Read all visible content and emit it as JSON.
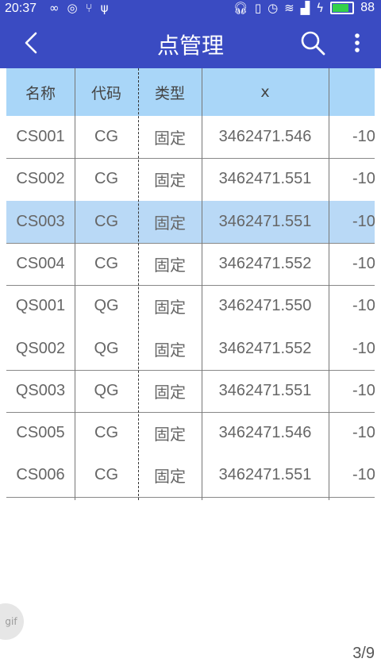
{
  "status": {
    "time": "20:37",
    "battery": "88",
    "left_icons": [
      "infinity-icon",
      "circle-p-icon",
      "usb-icon",
      "usb-plug-icon"
    ],
    "right_icons": [
      "headset-icon",
      "vibrate-icon",
      "alarm-icon",
      "wifi-icon",
      "signal-icon",
      "bolt-icon",
      "battery-icon"
    ]
  },
  "appbar": {
    "title": "点管理",
    "back_icon": "back-arrow-icon",
    "search_icon": "search-icon",
    "more_icon": "more-vert-icon",
    "color": "#3a4bc2"
  },
  "table": {
    "headers": [
      "名称",
      "代码",
      "类型",
      "x",
      ""
    ],
    "header_color": "#a9d6f8",
    "selected_color": "#b9d9f6",
    "selected_row_index": 2,
    "rows": [
      {
        "name": "CS001",
        "code": "CG",
        "type": "固定",
        "x": "3462471.546",
        "y": "-10"
      },
      {
        "name": "CS002",
        "code": "CG",
        "type": "固定",
        "x": "3462471.551",
        "y": "-10"
      },
      {
        "name": "CS003",
        "code": "CG",
        "type": "固定",
        "x": "3462471.551",
        "y": "-10"
      },
      {
        "name": "CS004",
        "code": "CG",
        "type": "固定",
        "x": "3462471.552",
        "y": "-10"
      },
      {
        "name": "QS001",
        "code": "QG",
        "type": "固定",
        "x": "3462471.550",
        "y": "-10"
      },
      {
        "name": "QS002",
        "code": "QG",
        "type": "固定",
        "x": "3462471.552",
        "y": "-10"
      },
      {
        "name": "QS003",
        "code": "QG",
        "type": "固定",
        "x": "3462471.551",
        "y": "-10"
      },
      {
        "name": "CS005",
        "code": "CG",
        "type": "固定",
        "x": "3462471.546",
        "y": "-10"
      },
      {
        "name": "CS006",
        "code": "CG",
        "type": "固定",
        "x": "3462471.551",
        "y": "-10"
      }
    ]
  },
  "overlay": {
    "gif_label": "gif",
    "pager": "3/9"
  }
}
